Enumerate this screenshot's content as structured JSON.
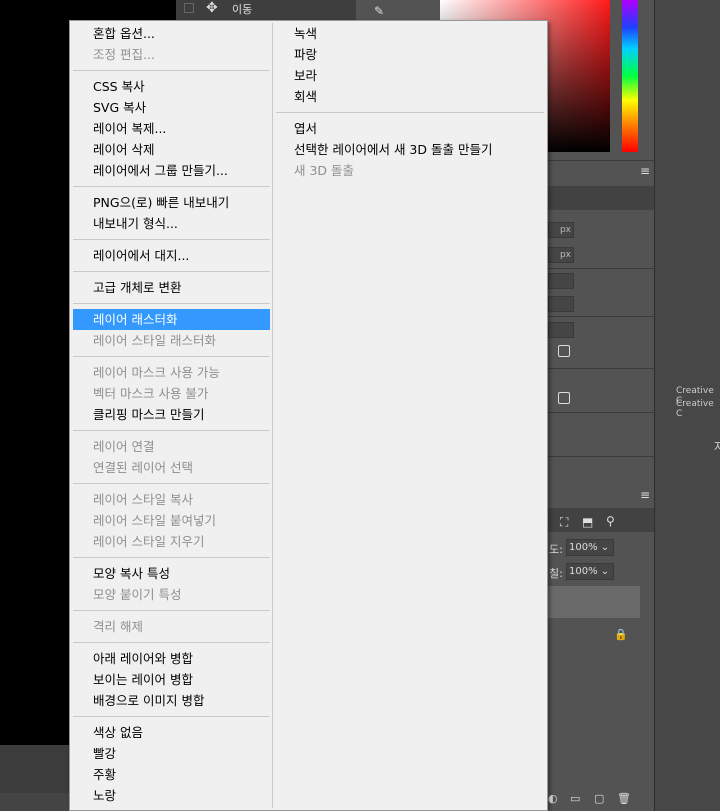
{
  "background": {
    "move_label": "이동",
    "move_icon": "move-arrows-icon",
    "side_text_1": "Creative C",
    "side_text_2": "Creative C",
    "side_glyph": "자",
    "opacity_label": "도:",
    "opacity_value": "100% ⌄",
    "fill_label": "칠:",
    "fill_value": "100% ⌄",
    "px_box_1": "px",
    "px_box_2": "px",
    "colors": {
      "selected": "#3399ff",
      "menu_bg": "#f0f0f0",
      "disabled": "#8f8f8f"
    }
  },
  "menu": {
    "left": [
      {
        "label": "혼합 옵션...",
        "disabled": false
      },
      {
        "label": "조정 편집...",
        "disabled": true
      },
      {
        "sep": true
      },
      {
        "label": "CSS 복사",
        "disabled": false
      },
      {
        "label": "SVG 복사",
        "disabled": false
      },
      {
        "label": "레이어 복제...",
        "disabled": false
      },
      {
        "label": "레이어 삭제",
        "disabled": false
      },
      {
        "label": "레이어에서 그룹 만들기...",
        "disabled": false
      },
      {
        "sep": true
      },
      {
        "label": "PNG으(로) 빠른 내보내기",
        "disabled": false
      },
      {
        "label": "내보내기 형식...",
        "disabled": false
      },
      {
        "sep": true
      },
      {
        "label": "레이어에서 대지...",
        "disabled": false
      },
      {
        "sep": true
      },
      {
        "label": "고급 개체로 변환",
        "disabled": false
      },
      {
        "sep": true
      },
      {
        "label": "레이어 래스터화",
        "disabled": false,
        "selected": true
      },
      {
        "label": "레이어 스타일 래스터화",
        "disabled": true
      },
      {
        "sep": true
      },
      {
        "label": "레이어 마스크 사용 가능",
        "disabled": true
      },
      {
        "label": "벡터 마스크 사용 불가",
        "disabled": true
      },
      {
        "label": "클리핑 마스크 만들기",
        "disabled": false
      },
      {
        "sep": true
      },
      {
        "label": "레이어 연결",
        "disabled": true
      },
      {
        "label": "연결된 레이어 선택",
        "disabled": true
      },
      {
        "sep": true
      },
      {
        "label": "레이어 스타일 복사",
        "disabled": true
      },
      {
        "label": "레이어 스타일 붙여넣기",
        "disabled": true
      },
      {
        "label": "레이어 스타일 지우기",
        "disabled": true
      },
      {
        "sep": true
      },
      {
        "label": "모양 복사 특성",
        "disabled": false
      },
      {
        "label": "모양 붙이기 특성",
        "disabled": true
      },
      {
        "sep": true
      },
      {
        "label": "격리 해제",
        "disabled": true
      },
      {
        "sep": true
      },
      {
        "label": "아래 레이어와 병합",
        "disabled": false
      },
      {
        "label": "보이는 레이어 병합",
        "disabled": false
      },
      {
        "label": "배경으로 이미지 병합",
        "disabled": false
      },
      {
        "sep": true
      },
      {
        "label": "색상 없음",
        "disabled": false
      },
      {
        "label": "빨강",
        "disabled": false
      },
      {
        "label": "주황",
        "disabled": false
      },
      {
        "label": "노랑",
        "disabled": false
      }
    ],
    "right": [
      {
        "label": "녹색",
        "disabled": false
      },
      {
        "label": "파랑",
        "disabled": false
      },
      {
        "label": "보라",
        "disabled": false
      },
      {
        "label": "회색",
        "disabled": false
      },
      {
        "sep": true
      },
      {
        "label": "엽서",
        "disabled": false
      },
      {
        "label": "선택한 레이어에서 새 3D 돌출 만들기",
        "disabled": false
      },
      {
        "label": "새 3D 돌출",
        "disabled": true
      }
    ]
  }
}
